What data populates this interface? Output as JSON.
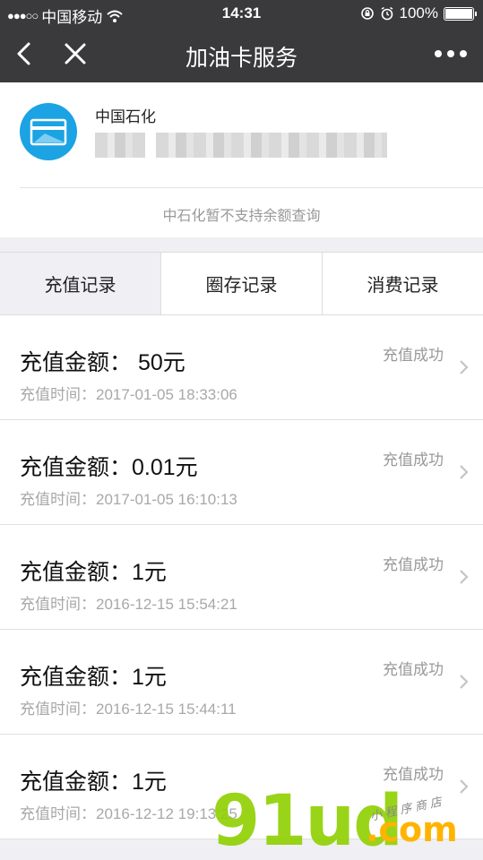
{
  "status_bar": {
    "signal_dots": "●●●○○",
    "carrier": "中国移动",
    "time": "14:31",
    "battery": "100%",
    "icons": [
      "wifi-icon",
      "rotation-lock-icon",
      "alarm-icon",
      "battery-icon"
    ]
  },
  "nav": {
    "title": "加油卡服务",
    "icons": [
      "back-icon",
      "close-icon",
      "more-icon"
    ]
  },
  "card": {
    "company": "中国石化",
    "note": "中石化暂不支持余额查询",
    "logo_color": "#1ba3e4"
  },
  "tabs": [
    {
      "label": "充值记录",
      "active": true
    },
    {
      "label": "圈存记录",
      "active": false
    },
    {
      "label": "消费记录",
      "active": false
    }
  ],
  "records": [
    {
      "amount_label": "充值金额：",
      "amount": " 50元",
      "time_label": "充值时间：",
      "time": "2017-01-05 18:33:06",
      "status": "充值成功"
    },
    {
      "amount_label": "充值金额：",
      "amount": "0.01元",
      "time_label": "充值时间：",
      "time": "2017-01-05 16:10:13",
      "status": "充值成功"
    },
    {
      "amount_label": "充值金额：",
      "amount": "1元",
      "time_label": "充值时间：",
      "time": "2016-12-15 15:54:21",
      "status": "充值成功"
    },
    {
      "amount_label": "充值金额：",
      "amount": "1元",
      "time_label": "充值时间：",
      "time": "2016-12-15 15:44:11",
      "status": "充值成功"
    },
    {
      "amount_label": "充值金额：",
      "amount": "1元",
      "time_label": "充值时间：",
      "time": "2016-12-12 19:13:25",
      "status": "充值成功"
    }
  ],
  "watermark": {
    "brand": "91ud",
    "domain": ".com",
    "tagline": "小程序商店"
  },
  "colors": {
    "nav_bg": "#3a3a3c",
    "page_bg": "#efeff4",
    "watermark_green": "#8fd000",
    "watermark_orange": "#ffb400"
  }
}
